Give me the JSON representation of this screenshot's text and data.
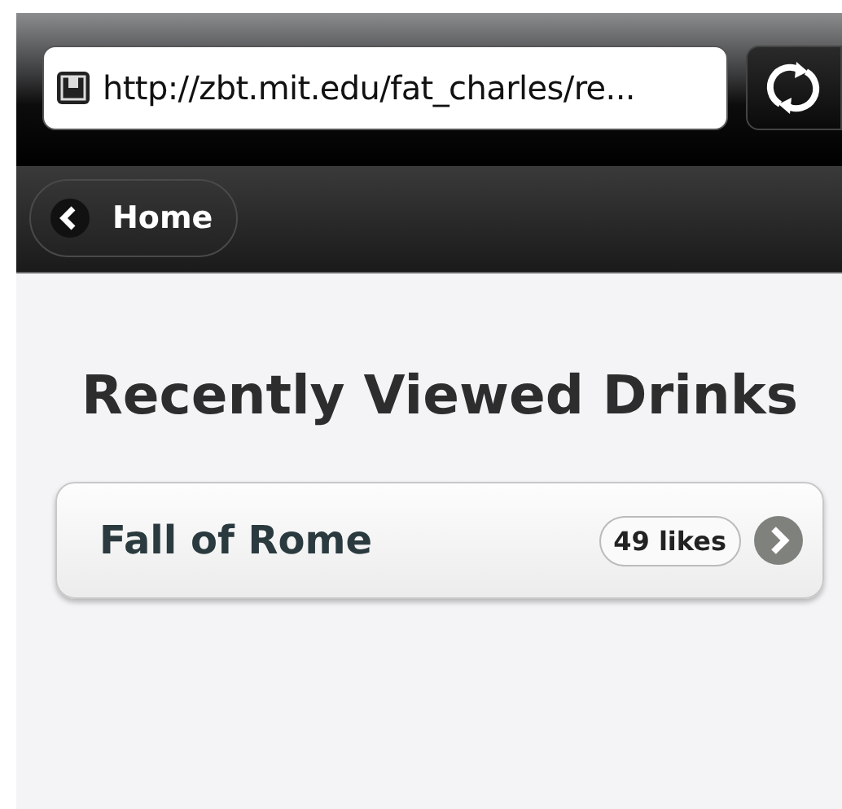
{
  "browser": {
    "url": "http://zbt.mit.edu/fat_charles/re..."
  },
  "header": {
    "back_button": "Home"
  },
  "page": {
    "title": "Recently Viewed Drinks",
    "items": [
      {
        "name": "Fall of Rome",
        "count": "49 likes"
      }
    ]
  }
}
